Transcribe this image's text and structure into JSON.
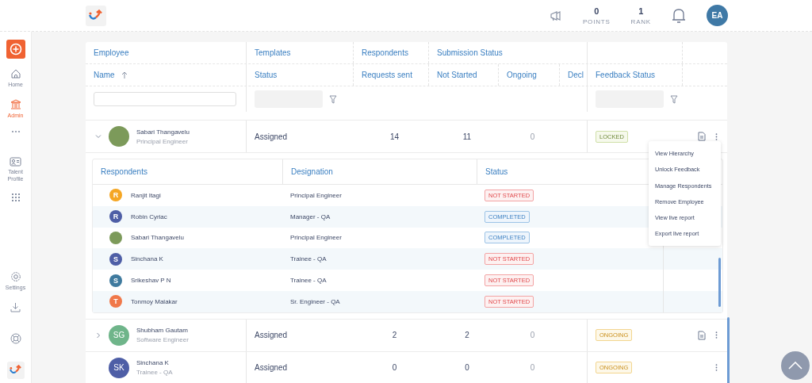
{
  "topbar": {
    "points": {
      "value": "0",
      "label": "POINTS"
    },
    "rank": {
      "value": "1",
      "label": "RANK"
    },
    "avatar": "EA"
  },
  "sidebar": {
    "items": [
      {
        "kind": "add",
        "selected": false
      },
      {
        "kind": "home",
        "label": "Home",
        "selected": false
      },
      {
        "kind": "admin",
        "label": "Admin",
        "selected": true
      },
      {
        "kind": "more",
        "selected": false
      },
      {
        "kind": "talent",
        "label": "Talent Profile",
        "selected": false
      },
      {
        "kind": "apps",
        "selected": false
      },
      {
        "kind": "settings",
        "label": "Settings",
        "selected": false
      },
      {
        "kind": "download",
        "selected": false
      },
      {
        "kind": "help",
        "selected": false
      },
      {
        "kind": "logo",
        "selected": false
      }
    ]
  },
  "table": {
    "groups": [
      "Employee",
      "Templates",
      "Respondents",
      "Submission Status"
    ],
    "columns": [
      "Name",
      "Status",
      "Requests sent",
      "Not Started",
      "Ongoing",
      "Decl",
      "Feedback Status"
    ],
    "rows": [
      {
        "name": "Sabari Thangavelu",
        "title": "Principal Engineer",
        "avatar": {
          "kind": "photo"
        },
        "expanded": true,
        "status": "Assigned",
        "requests_sent": "14",
        "not_started": "11",
        "ongoing": "0",
        "feedback": {
          "label": "LOCKED",
          "kind": "locked"
        },
        "actions": [
          {
            "kind": "document"
          },
          {
            "kind": "more"
          }
        ],
        "menu": [
          "View Hierarchy",
          "Unlock Feedback",
          "Manage Respondents",
          "Remove Employee",
          "View live report",
          "Export live report"
        ],
        "respondents": {
          "columns": [
            "Respondents",
            "Designation",
            "Status"
          ],
          "rows": [
            {
              "kind": "initial",
              "initial": "R",
              "color": "#f5a623",
              "name": "Ranjit Itagi",
              "designation": "Principal Engineer",
              "status": {
                "label": "NOT STARTED",
                "kind": "not_started"
              }
            },
            {
              "kind": "initial",
              "initial": "R",
              "color": "#4e5ea6",
              "name": "Robin Cyriac",
              "designation": "Manager - QA",
              "status": {
                "label": "COMPLETED",
                "kind": "completed"
              }
            },
            {
              "kind": "photo",
              "name": "Sabari Thangavelu",
              "designation": "Principal Engineer",
              "status": {
                "label": "COMPLETED",
                "kind": "completed"
              }
            },
            {
              "kind": "initial",
              "initial": "S",
              "color": "#4e5ea6",
              "name": "Sinchana K",
              "designation": "Trainee - QA",
              "status": {
                "label": "NOT STARTED",
                "kind": "not_started"
              }
            },
            {
              "kind": "initial",
              "initial": "S",
              "color": "#3f7a9e",
              "name": "Srikeshav P N",
              "designation": "Trainee - QA",
              "status": {
                "label": "NOT STARTED",
                "kind": "not_started"
              }
            },
            {
              "kind": "initial",
              "initial": "T",
              "color": "#f0784a",
              "name": "Tonmoy Malakar",
              "designation": "Sr. Engineer - QA",
              "status": {
                "label": "NOT STARTED",
                "kind": "not_started"
              }
            }
          ]
        }
      },
      {
        "name": "Shubham Gautam",
        "title": "Software Engineer",
        "avatar": {
          "kind": "initials",
          "initials": "SG",
          "color": "#6fb58a"
        },
        "expanded": false,
        "status": "Assigned",
        "requests_sent": "2",
        "not_started": "2",
        "ongoing": "0",
        "feedback": {
          "label": "ONGOING",
          "kind": "ongoing"
        },
        "actions": [
          {
            "kind": "document"
          },
          {
            "kind": "more"
          }
        ]
      },
      {
        "name": "Sinchana K",
        "title": "Trainee - QA",
        "avatar": {
          "kind": "initials",
          "initials": "SK",
          "color": "#4e5ea6"
        },
        "status": "Assigned",
        "requests_sent": "0",
        "not_started": "0",
        "ongoing": "0",
        "feedback": {
          "label": "ONGOING",
          "kind": "ongoing"
        },
        "actions": [
          {
            "kind": "more"
          }
        ]
      }
    ]
  }
}
